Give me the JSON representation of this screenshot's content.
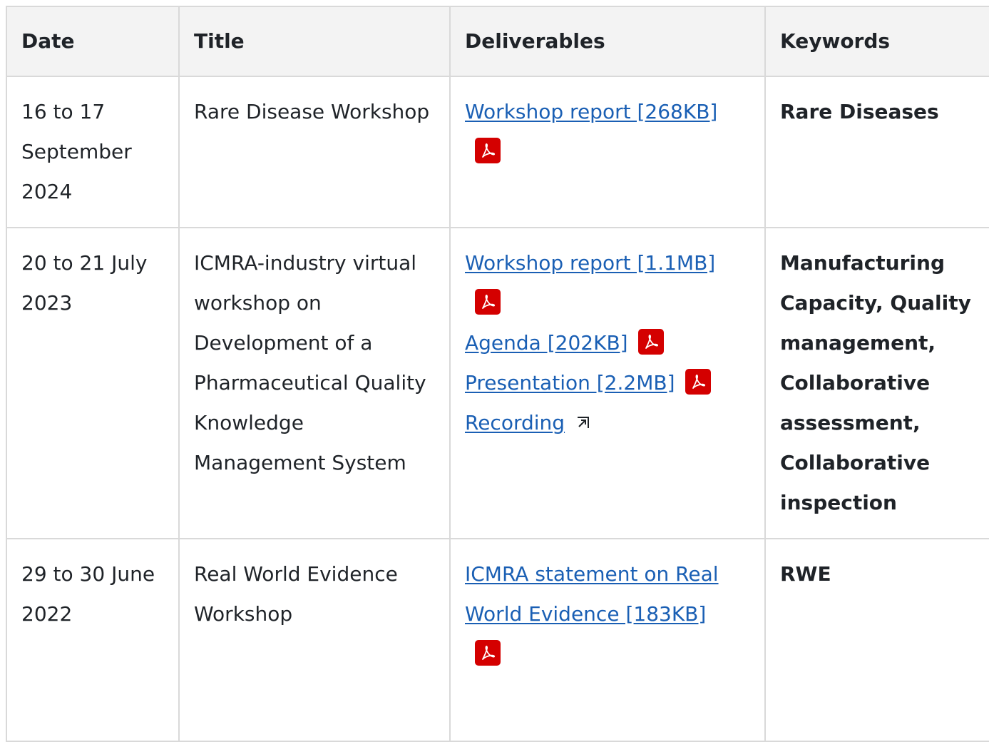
{
  "headers": {
    "date": "Date",
    "title": "Title",
    "deliverables": "Deliverables",
    "keywords": "Keywords"
  },
  "rows": [
    {
      "date": "16 to 17 September 2024",
      "title": "Rare Disease Workshop",
      "deliverables": [
        {
          "label": "Workshop report [268KB]",
          "icon": "pdf-icon"
        }
      ],
      "keywords": "Rare Diseases"
    },
    {
      "date": "20 to 21 July 2023",
      "title": "ICMRA-industry virtual workshop on Development of a Pharmaceutical Quality Knowledge Management System",
      "deliverables": [
        {
          "label": "Workshop report [1.1MB]",
          "icon": "pdf-icon"
        },
        {
          "label": "Agenda [202KB]",
          "icon": "pdf-icon"
        },
        {
          "label": "Presentation [2.2MB]",
          "icon": "pdf-icon"
        },
        {
          "label": "Recording",
          "icon": "external-link-icon"
        }
      ],
      "keywords": "Manufacturing Capacity, Quality management, Collaborative assessment, Collaborative inspection"
    },
    {
      "date": "29 to 30 June 2022",
      "title": "Real World Evidence Workshop",
      "deliverables": [
        {
          "label": "ICMRA statement on Real World Evidence [183KB]",
          "icon": "pdf-icon"
        }
      ],
      "keywords": "RWE"
    }
  ],
  "colors": {
    "link": "#1a5fb4",
    "pdf_badge": "#d40000",
    "header_bg": "#f3f3f3",
    "border": "#d9d9d9"
  }
}
